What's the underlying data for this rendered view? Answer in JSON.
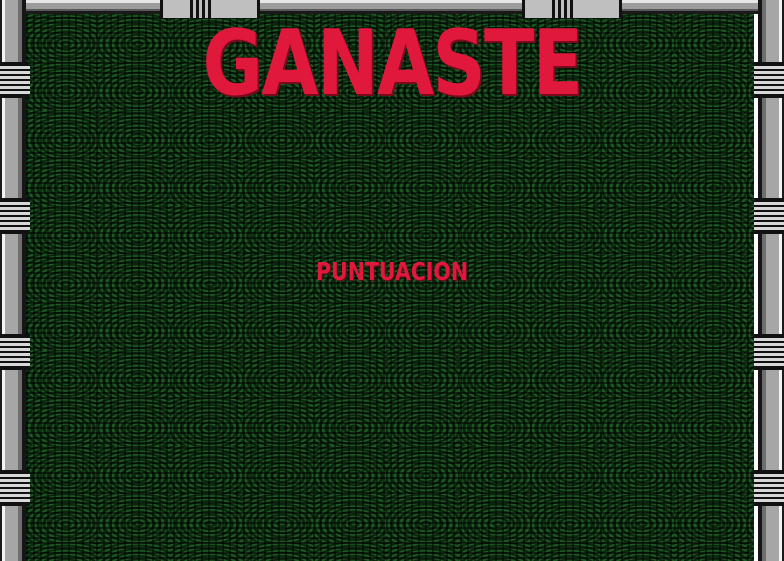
{
  "screen": {
    "title": "GANASTE",
    "score_label": "PUNTUACION",
    "title_color": "#e0193c",
    "playfield_color": "#0d2f12"
  }
}
